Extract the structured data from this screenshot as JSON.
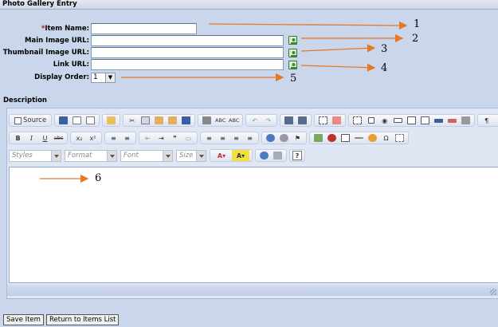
{
  "window": {
    "title": "Photo Gallery Entry"
  },
  "form": {
    "item_name": {
      "required_mark": "*",
      "label": "Item Name:",
      "value": ""
    },
    "main_image_url": {
      "label": "Main Image URL:",
      "value": ""
    },
    "thumbnail_image_url": {
      "label": "Thumbnail Image URL:",
      "value": ""
    },
    "link_url": {
      "label": "Link URL:",
      "value": ""
    },
    "display_order": {
      "label": "Display Order:",
      "value": "1"
    }
  },
  "description": {
    "label": "Description",
    "toolbar": {
      "source_label": "Source",
      "styles_placeholder": "Styles",
      "format_placeholder": "Format",
      "font_placeholder": "Font",
      "size_placeholder": "Size"
    },
    "content": ""
  },
  "actions": {
    "save_label": "Save Item",
    "return_label": "Return to Items List"
  },
  "annotations": [
    "1",
    "2",
    "3",
    "4",
    "5",
    "6"
  ],
  "colors": {
    "arrow": "#e87722",
    "required": "#cc0000",
    "background": "#c9d6ec"
  }
}
